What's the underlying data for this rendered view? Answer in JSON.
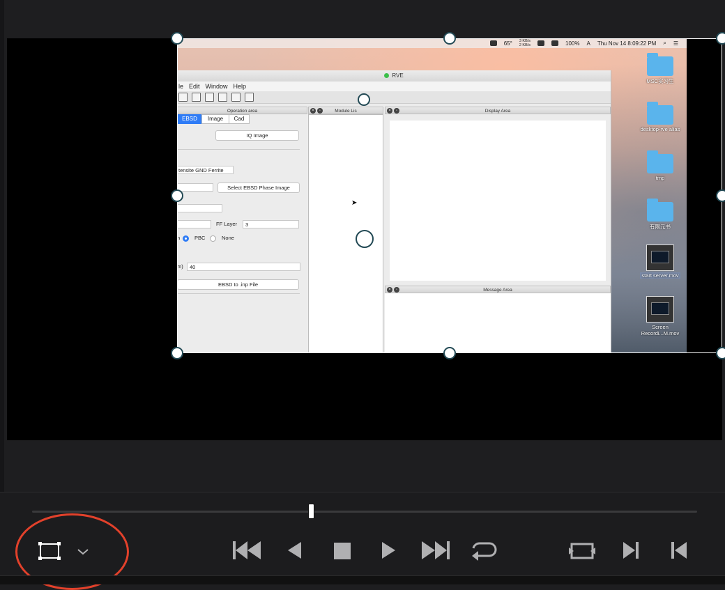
{
  "screen": {
    "menubar": {
      "weather": "65°",
      "net_up": "3 KB/s",
      "net_down": "2 KB/s",
      "battery": "100%",
      "input_source": "A",
      "clock": "Thu Nov 14  8:09:22 PM"
    },
    "desktop_icons": [
      {
        "label": "MSC实习生"
      },
      {
        "label": "desktop-rve alias"
      },
      {
        "label": "tmp"
      },
      {
        "label": "有限元书"
      },
      {
        "label": "start server.mov"
      },
      {
        "label": "Screen Recordi...M.mov"
      }
    ],
    "app": {
      "window_title": "RVE",
      "menu": [
        "le",
        "Edit",
        "Window",
        "Help"
      ],
      "operation_area_title": "Operation area",
      "tabs": [
        {
          "label": "EBSD",
          "selected": true
        },
        {
          "label": "Image",
          "selected": false
        },
        {
          "label": "Cad",
          "selected": false
        }
      ],
      "iq_image_button": "IQ Image",
      "phase_field_value": "tensite GND Ferrite",
      "select_phase_button": "Select EBSD Phase Image",
      "ff_layer_label": "FF Layer",
      "ff_layer_value": "3",
      "boundary_radio": {
        "prefix": "n",
        "options": [
          {
            "label": "PBC",
            "selected": true
          },
          {
            "label": "None",
            "selected": false
          }
        ]
      },
      "size_label": "m)",
      "size_value": "40",
      "export_button": "EBSD to .inp File",
      "module_list_title": "Module Lis",
      "display_area_title": "Display Area",
      "message_area_title": "Message Area"
    }
  },
  "controls": {
    "playhead_position": 0.42,
    "buttons": [
      {
        "name": "crop-mode",
        "icon": "crop-frame-icon"
      },
      {
        "name": "crop-dropdown",
        "icon": "chevron-down-icon"
      },
      {
        "name": "jump-to-start",
        "icon": "skip-to-start-icon"
      },
      {
        "name": "play-reverse",
        "icon": "play-reverse-icon"
      },
      {
        "name": "stop",
        "icon": "stop-icon"
      },
      {
        "name": "play",
        "icon": "play-icon"
      },
      {
        "name": "jump-to-end",
        "icon": "skip-to-end-icon"
      },
      {
        "name": "loop",
        "icon": "loop-icon"
      },
      {
        "name": "match-frame",
        "icon": "match-frame-icon"
      },
      {
        "name": "next-edit",
        "icon": "next-edit-icon"
      },
      {
        "name": "previous-edit",
        "icon": "previous-edit-icon"
      }
    ],
    "highlight_color": "#e2412b"
  }
}
